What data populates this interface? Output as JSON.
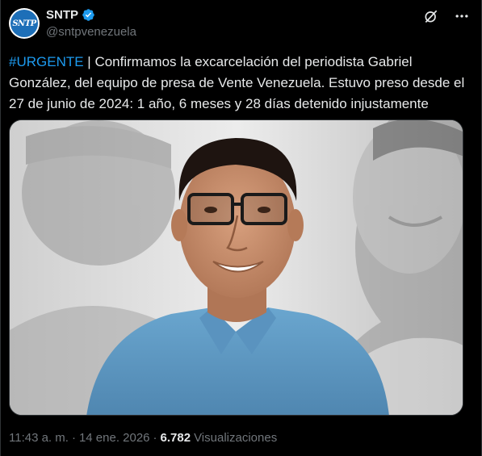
{
  "author": {
    "avatar_text": "SNTP",
    "display_name": "SNTP",
    "handle": "@sntpvenezuela",
    "verified": true
  },
  "icons": {
    "grok": "grok-slash-icon",
    "more": "more-dots-icon",
    "verified": "verified-badge-icon"
  },
  "tweet": {
    "hashtag": "#URGENTE",
    "body": " | Confirmamos la excarcelación del periodista Gabriel González, del equipo de presa de Vente Venezuela. Estuvo preso desde el 27 de junio de 2024: 1 año, 6 meses y 28 días detenido injustamente"
  },
  "meta": {
    "time": "11:43 a. m.",
    "sep1": "·",
    "date": "14 ene. 2026",
    "sep2": "·",
    "views_count": "6.782",
    "views_label": "Visualizaciones"
  },
  "colors": {
    "background": "#000000",
    "text": "#e7e9ea",
    "secondary": "#71767b",
    "link": "#1d9bf0",
    "verified": "#1d9bf0",
    "shirt": "#5b97c2"
  }
}
